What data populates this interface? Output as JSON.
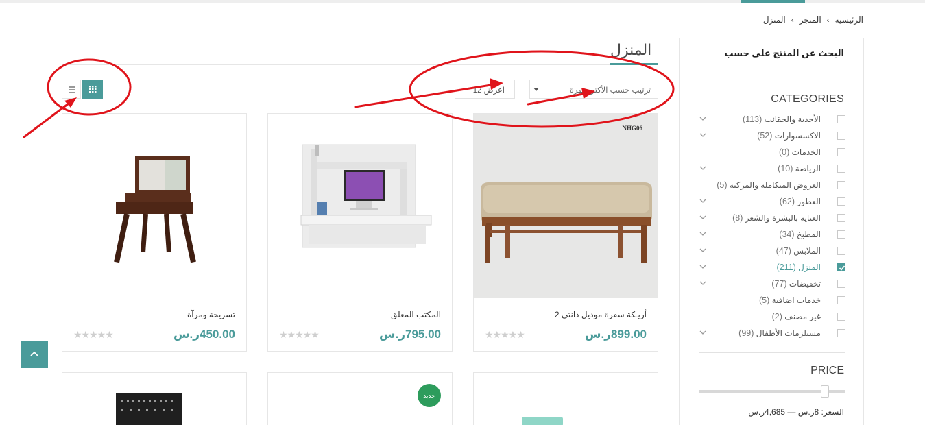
{
  "breadcrumb": [
    "الرئيسية",
    "المتجر",
    "المنزل"
  ],
  "sidebar": {
    "heading": "البحث عن المنتج على حسب",
    "categories_title": "CATEGORIES",
    "categories": [
      {
        "label": "الأحذية والحقائب",
        "count": "(113)",
        "checked": false,
        "expandable": true
      },
      {
        "label": "الاكسسوارات",
        "count": "(52)",
        "checked": false,
        "expandable": true
      },
      {
        "label": "الخدمات",
        "count": "(0)",
        "checked": false,
        "expandable": false
      },
      {
        "label": "الرياضة",
        "count": "(10)",
        "checked": false,
        "expandable": true
      },
      {
        "label": "العروض المتكاملة والمركبة",
        "count": "(5)",
        "checked": false,
        "expandable": false
      },
      {
        "label": "العطور",
        "count": "(62)",
        "checked": false,
        "expandable": true
      },
      {
        "label": "العناية بالبشرة والشعر",
        "count": "(8)",
        "checked": false,
        "expandable": true
      },
      {
        "label": "المطبخ",
        "count": "(34)",
        "checked": false,
        "expandable": true
      },
      {
        "label": "الملابس",
        "count": "(47)",
        "checked": false,
        "expandable": true
      },
      {
        "label": "المنزل",
        "count": "(211)",
        "checked": true,
        "expandable": true
      },
      {
        "label": "تخفيضات",
        "count": "(77)",
        "checked": false,
        "expandable": true
      },
      {
        "label": "خدمات اضافية",
        "count": "(5)",
        "checked": false,
        "expandable": false
      },
      {
        "label": "غير مصنف",
        "count": "(2)",
        "checked": false,
        "expandable": false
      },
      {
        "label": "مستلزمات الأطفال",
        "count": "(99)",
        "checked": false,
        "expandable": true
      }
    ],
    "price_title": "PRICE",
    "price_text": "السعر: 8ر.س — 4,685ر.س"
  },
  "main": {
    "title": "المنزل",
    "sort_label": "ترتيب حسب الأكثر شهرة",
    "show_label": "اعرض 12"
  },
  "products": [
    {
      "name": "أريـكة سفرة موديل دانتي 2",
      "price": "899.00ر.س",
      "image": "bench",
      "stamp": "NHG06"
    },
    {
      "name": "المكتب المعلق",
      "price": "795.00ر.س",
      "image": "wall-desk"
    },
    {
      "name": "تسريحة ومرآة",
      "price": "450.00ر.س",
      "image": "vanity"
    }
  ],
  "bottom_row": {
    "badge": "جديد"
  },
  "stars": "★★★★★",
  "colors": {
    "accent": "#4a9b9a",
    "annotation": "#e0141b",
    "badge": "#2d9c5c"
  }
}
